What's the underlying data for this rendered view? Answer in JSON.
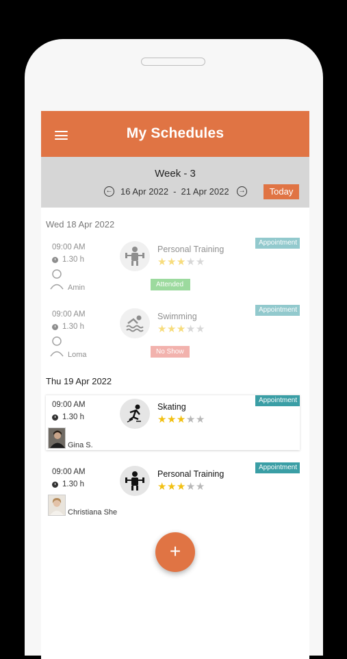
{
  "header": {
    "title": "My Schedules"
  },
  "week": {
    "title": "Week - 3",
    "start": "16 Apr 2022",
    "separator": "-",
    "end": "21 Apr 2022",
    "today_label": "Today"
  },
  "days": [
    {
      "label": "Wed 18 Apr 2022",
      "appointments": [
        {
          "time": "09:00 AM",
          "duration": "1.30 h",
          "person": "Amin",
          "activity": "Personal Training",
          "activity_icon": "training-icon",
          "rating": 3,
          "tag": "Appointment",
          "status": "Attended"
        },
        {
          "time": "09:00 AM",
          "duration": "1.30 h",
          "person": "Loma",
          "activity": "Swimming",
          "activity_icon": "swimming-icon",
          "rating": 3,
          "tag": "Appointment",
          "status": "No Show"
        }
      ]
    },
    {
      "label": "Thu 19 Apr 2022",
      "appointments": [
        {
          "time": "09:00 AM",
          "duration": "1.30 h",
          "person": "Gina S.",
          "activity": "Skating",
          "activity_icon": "skating-icon",
          "rating": 3,
          "tag": "Appointment"
        },
        {
          "time": "09:00 AM",
          "duration": "1.30 h",
          "person": "Christiana She",
          "activity": "Personal Training",
          "activity_icon": "training-icon",
          "rating": 3,
          "tag": "Appointment"
        }
      ]
    }
  ],
  "fab": {
    "label": "+"
  },
  "colors": {
    "accent": "#e07444",
    "tag": "#3a9ea5",
    "attended": "#4cbd4f",
    "no_show": "#e8756b",
    "star": "#f2c012"
  }
}
